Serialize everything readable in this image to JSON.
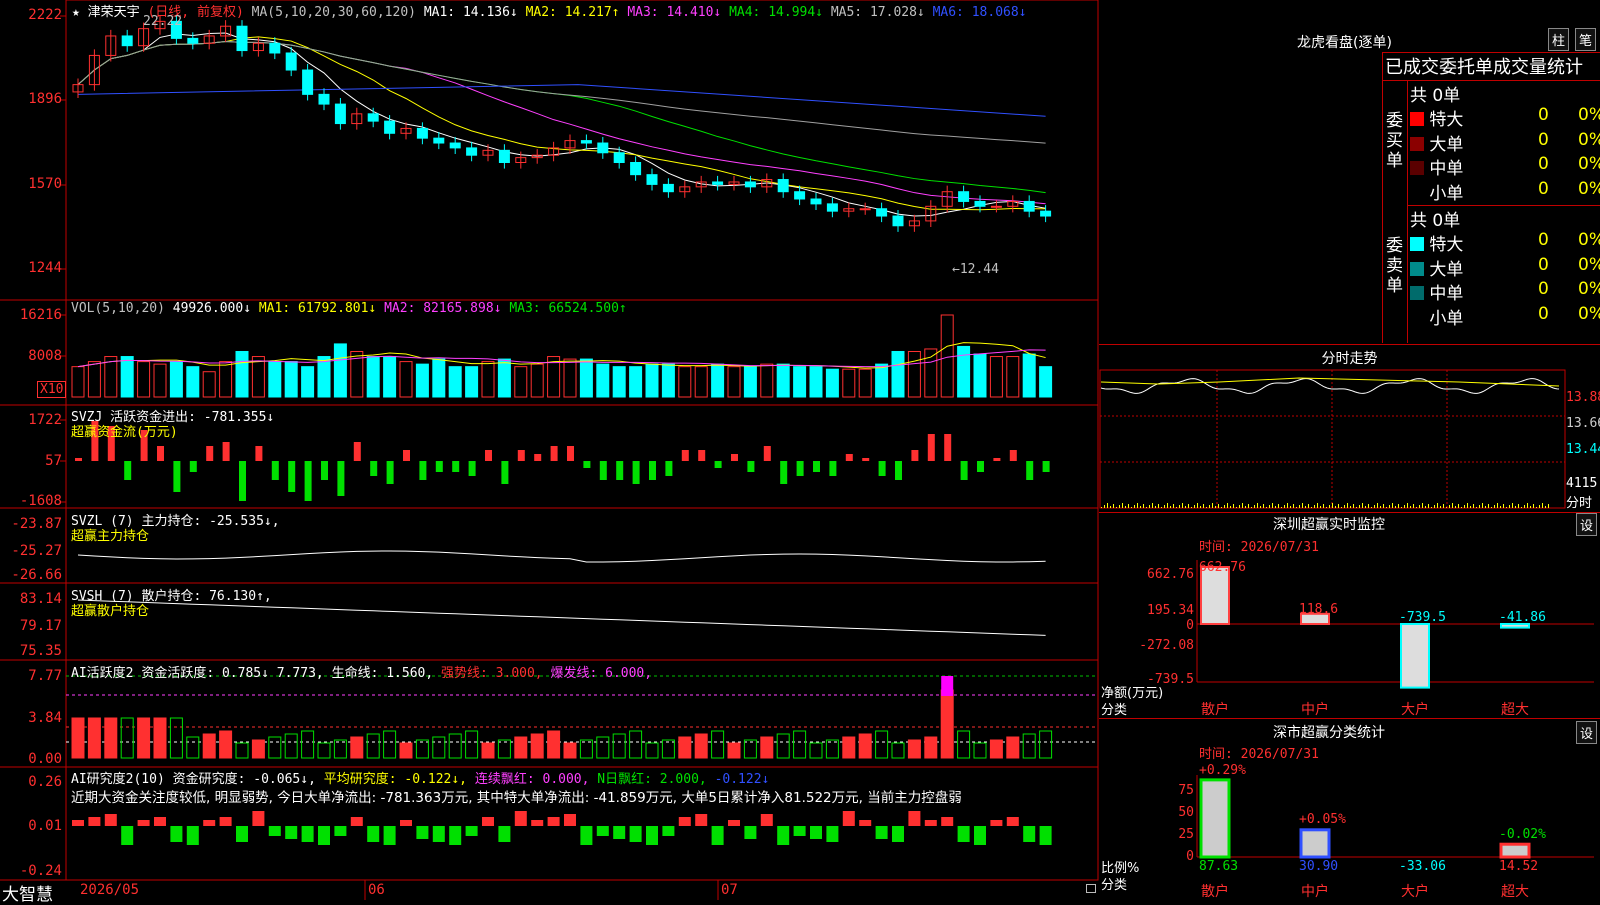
{
  "chart_header": {
    "stock": "★ 津荣天宇",
    "mode": "(日线, 前复权)",
    "ma_label": "MA(5,10,20,30,60,120)",
    "ma1": "MA1: 14.136↓",
    "ma2": "MA2: 14.217↑",
    "ma3": "MA3: 14.410↓",
    "ma4": "MA4: 14.994↓",
    "ma5": "MA5: 17.028↓",
    "ma6": "MA6: 18.068↓"
  },
  "price_axis": [
    "2222",
    "1896",
    "1570",
    "1244"
  ],
  "price_annotations": {
    "high": "22.22",
    "low": "←12.44"
  },
  "vol_header": {
    "label": "VOL(5,10,20)",
    "val": "49926.000↓",
    "ma1": "MA1: 61792.801↓",
    "ma2": "MA2: 82165.898↓",
    "ma3": "MA3: 66524.500↑"
  },
  "vol_axis": [
    "16216",
    "8008"
  ],
  "vol_unit": "X10",
  "svzj": {
    "label": "SVZJ",
    "text": "活跃资金进出: -781.355↓",
    "sub": "超赢资金流(万元)",
    "axis": [
      "1722",
      "57",
      "-1608"
    ]
  },
  "svzl": {
    "label": "SVZL (7)",
    "text": "主力持仓: -25.535↓,",
    "sub": "超赢主力持仓",
    "axis": [
      "-23.87",
      "-25.27",
      "-26.66"
    ]
  },
  "svsh": {
    "label": "SVSH (7)",
    "text": "散户持仓: 76.130↑,",
    "sub": "超赢散户持仓",
    "axis": [
      "83.14",
      "79.17",
      "75.35"
    ]
  },
  "ai1": {
    "label": "AI活跃度2",
    "a": "资金活跃度: 0.785↓",
    "b": "7.773,",
    "c": "生命线: 1.560,",
    "d": "强势线: 3.000,",
    "e": "爆发线: 6.000,",
    "axis": [
      "7.77",
      "3.84",
      "0.00"
    ]
  },
  "ai2": {
    "label": "AI研究度2(10)",
    "a": "资金研究度: -0.065↓,",
    "b": "平均研究度: -0.122↓,",
    "c": "连续飘红: 0.000,",
    "d": "N日飘红: 2.000,",
    "e": "-0.122↓",
    "desc": "近期大资金关注度较低, 明显弱势, 今日大单净流出: -781.363万元, 其中特大单净流出: -41.859万元, 大单5日累计净入81.522万元, 当前主力控盘弱",
    "axis": [
      "0.26",
      "0.01",
      "-0.24"
    ]
  },
  "date_axis": [
    "2026/05",
    "06",
    "07"
  ],
  "brand": "大智慧",
  "right_panel": {
    "lhkp_title": "龙虎看盘(逐单)",
    "btn_zhu": "柱",
    "btn_bi": "笔",
    "order_header": "已成交委托单成交量统计",
    "buy": {
      "side": "委买单",
      "total": "共 0单",
      "rows": [
        {
          "name": "特大",
          "count": "0",
          "pct": "0%"
        },
        {
          "name": "大单",
          "count": "0",
          "pct": "0%"
        },
        {
          "name": "中单",
          "count": "0",
          "pct": "0%"
        },
        {
          "name": "小单",
          "count": "0",
          "pct": "0%"
        }
      ]
    },
    "sell": {
      "side": "委卖单",
      "total": "共 0单",
      "rows": [
        {
          "name": "特大",
          "count": "0",
          "pct": "0%"
        },
        {
          "name": "大单",
          "count": "0",
          "pct": "0%"
        },
        {
          "name": "中单",
          "count": "0",
          "pct": "0%"
        },
        {
          "name": "小单",
          "count": "0",
          "pct": "0%"
        }
      ]
    },
    "intraday_title": "分时走势",
    "intraday_axis": [
      "13.88",
      "13.66",
      "13.44",
      "4115",
      "分时"
    ],
    "monitor_title": "深圳超赢实时监控",
    "monitor_btn": "设",
    "monitor_time": "时间: 2026/07/31",
    "monitor_axis": [
      "662.76",
      "195.34",
      "0",
      "-272.08",
      "-739.5"
    ],
    "monitor_ylabel": "净额(万元)",
    "monitor_xlabel": "分类",
    "categories": [
      "散户",
      "中户",
      "大户",
      "超大"
    ],
    "monitor_values": [
      "662.76",
      "118.6",
      "-739.5",
      "-41.86"
    ],
    "classify_title": "深市超赢分类统计",
    "classify_btn": "设",
    "classify_time": "时间: 2026/07/31",
    "classify_axis": [
      "75",
      "50",
      "25",
      "0"
    ],
    "classify_ylabel": "比例%",
    "classify_xlabel": "分类",
    "classify_top": [
      "+0.29%",
      "+0.05%",
      "-0.02%"
    ],
    "classify_values": [
      "87.63",
      "30.90",
      "-33.06",
      "14.52"
    ]
  },
  "colors": {
    "up": "#ff3030",
    "down": "#00ffff",
    "ma1": "#ffffff",
    "ma2": "#ffff00",
    "ma3": "#ff40ff",
    "ma4": "#00e000",
    "ma5": "#a0a0a0",
    "ma6": "#3050ff"
  },
  "chart_data": [
    {
      "type": "candlestick",
      "title": "津荣天宇 日线",
      "x_range": [
        "2026/05",
        "2026/07/31"
      ],
      "ylim": [
        12.44,
        22.22
      ],
      "ohlc_close": [
        19.4,
        20.6,
        21.4,
        21.0,
        21.7,
        22.0,
        21.3,
        21.1,
        21.4,
        21.8,
        20.8,
        21.1,
        20.7,
        20.0,
        19.0,
        18.6,
        17.8,
        18.2,
        17.9,
        17.4,
        17.6,
        17.2,
        17.0,
        16.8,
        16.5,
        16.7,
        16.2,
        16.4,
        16.5,
        16.8,
        17.1,
        17.0,
        16.6,
        16.2,
        15.7,
        15.3,
        15.0,
        15.2,
        15.4,
        15.3,
        15.4,
        15.2,
        15.5,
        15.0,
        14.7,
        14.5,
        14.2,
        14.3,
        14.3,
        14.0,
        13.6,
        13.8,
        14.4,
        15.0,
        14.6,
        14.4,
        14.4,
        14.6,
        14.2,
        14.0
      ]
    },
    {
      "type": "bar",
      "title": "VOL",
      "ylim": [
        0,
        16216
      ],
      "values": [
        6000,
        7000,
        8000,
        8000,
        7000,
        6500,
        7000,
        6000,
        5000,
        7000,
        9000,
        8000,
        7000,
        7000,
        6000,
        8000,
        10500,
        9000,
        8000,
        8000,
        7000,
        6500,
        7500,
        6000,
        6000,
        7000,
        7500,
        6000,
        6500,
        8000,
        7500,
        7500,
        6500,
        6000,
        6000,
        6500,
        6500,
        6000,
        6000,
        6500,
        6000,
        6000,
        6500,
        6500,
        6000,
        6000,
        5500,
        5500,
        5500,
        6500,
        9000,
        9000,
        9500,
        16216,
        10000,
        8500,
        8000,
        8000,
        8500,
        6000
      ]
    }
  ]
}
